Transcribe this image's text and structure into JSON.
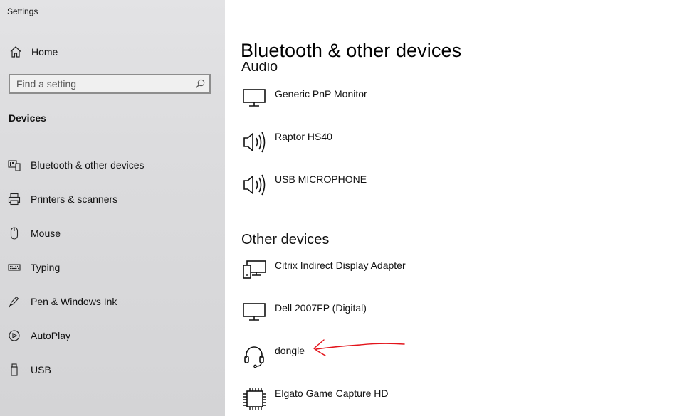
{
  "window": {
    "title": "Settings"
  },
  "sidebar": {
    "home_label": "Home",
    "search_placeholder": "Find a setting",
    "section": "Devices",
    "items": [
      {
        "label": "Bluetooth & other devices",
        "icon": "bluetooth-devices-icon"
      },
      {
        "label": "Printers & scanners",
        "icon": "printer-icon"
      },
      {
        "label": "Mouse",
        "icon": "mouse-icon"
      },
      {
        "label": "Typing",
        "icon": "keyboard-icon"
      },
      {
        "label": "Pen & Windows Ink",
        "icon": "pen-icon"
      },
      {
        "label": "AutoPlay",
        "icon": "autoplay-icon"
      },
      {
        "label": "USB",
        "icon": "usb-icon"
      }
    ]
  },
  "main": {
    "title": "Bluetooth & other devices",
    "audio": {
      "header": "Audio",
      "devices": [
        {
          "name": "Generic PnP Monitor",
          "icon": "monitor-icon"
        },
        {
          "name": "Raptor HS40",
          "icon": "speaker-icon"
        },
        {
          "name": "USB MICROPHONE",
          "icon": "speaker-icon"
        }
      ]
    },
    "other": {
      "header": "Other devices",
      "devices": [
        {
          "name": "Citrix Indirect Display Adapter",
          "icon": "display-adapter-icon"
        },
        {
          "name": "Dell 2007FP (Digital)",
          "icon": "monitor-icon"
        },
        {
          "name": "dongle",
          "icon": "headset-icon"
        },
        {
          "name": "Elgato Game Capture HD",
          "icon": "chip-icon"
        }
      ]
    }
  },
  "colors": {
    "annotation_arrow": "#e3141b",
    "sidebar_bg": "#dcdcde"
  }
}
